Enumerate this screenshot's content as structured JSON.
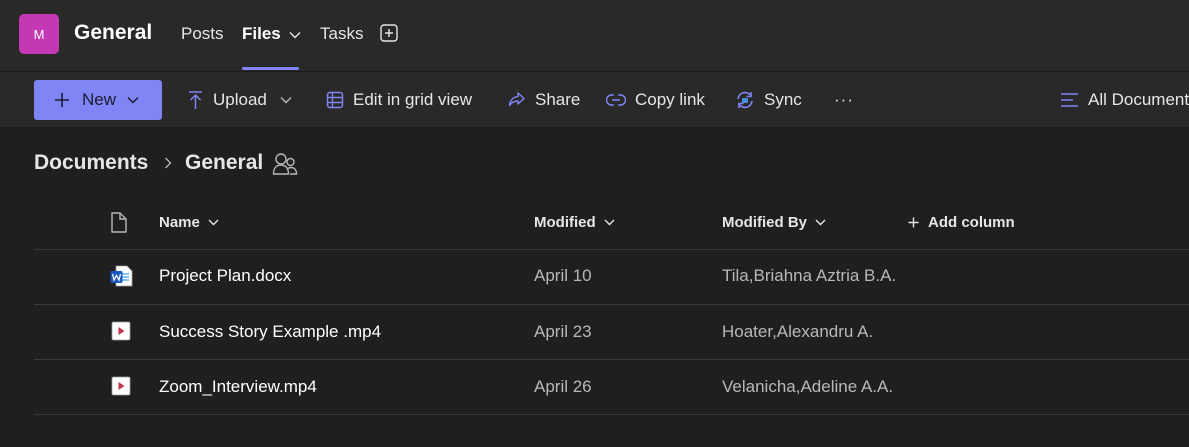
{
  "header": {
    "avatar_initial": "M",
    "channel_title": "General",
    "tabs": [
      {
        "label": "Posts"
      },
      {
        "label": "Files"
      },
      {
        "label": "Tasks"
      }
    ]
  },
  "toolbar": {
    "new_label": "New",
    "upload_label": "Upload",
    "grid_label": "Edit in grid view",
    "share_label": "Share",
    "copy_link_label": "Copy link",
    "sync_label": "Sync",
    "more_label": "···",
    "view_label": "All Documents"
  },
  "breadcrumb": {
    "root": "Documents",
    "current": "General"
  },
  "list": {
    "columns": {
      "name": "Name",
      "modified": "Modified",
      "modified_by": "Modified By",
      "add_column": "Add column"
    },
    "rows": [
      {
        "name": "Project Plan.docx",
        "modified": "April 10",
        "modified_by": "Tila,Briahna Aztria B.A.",
        "icon": "word-doc-icon"
      },
      {
        "name": "Success Story Example .mp4",
        "modified": "April 23",
        "modified_by": "Hoater,Alexandru A.",
        "icon": "video-file-icon"
      },
      {
        "name": "Zoom_Interview.mp4",
        "modified": "April 26",
        "modified_by": "Velanicha,Adeline A.A.",
        "icon": "video-file-icon"
      }
    ]
  },
  "colors": {
    "accent": "#7f85f5",
    "avatar": "#c239b3",
    "background": "#292929",
    "list_background": "#1f1f1f"
  }
}
